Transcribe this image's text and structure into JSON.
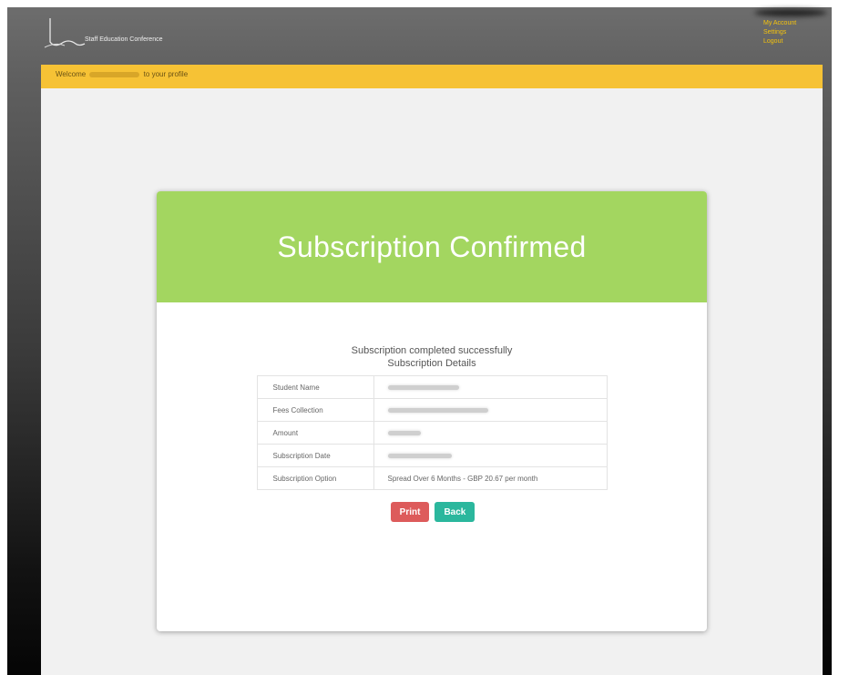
{
  "header": {
    "logo_text": "Staff Education Conference",
    "user_links": [
      "My Account",
      "Settings",
      "Logout"
    ]
  },
  "welcome": {
    "prefix": "Welcome",
    "suffix": "to your profile"
  },
  "card": {
    "title": "Subscription Confirmed",
    "message_line1": "Subscription completed successfully",
    "message_line2": "Subscription Details",
    "rows": [
      {
        "label": "Student Name",
        "value": ""
      },
      {
        "label": "Fees Collection",
        "value": ""
      },
      {
        "label": "Amount",
        "value": ""
      },
      {
        "label": "Subscription Date",
        "value": ""
      },
      {
        "label": "Subscription Option",
        "value": "Spread Over 6 Months - GBP 20.67 per month"
      }
    ],
    "print_label": "Print",
    "back_label": "Back"
  },
  "colors": {
    "header_green": "#a3d660",
    "welcome_yellow": "#f6c235",
    "print_red": "#dd5b5b",
    "back_teal": "#2bb79d"
  }
}
